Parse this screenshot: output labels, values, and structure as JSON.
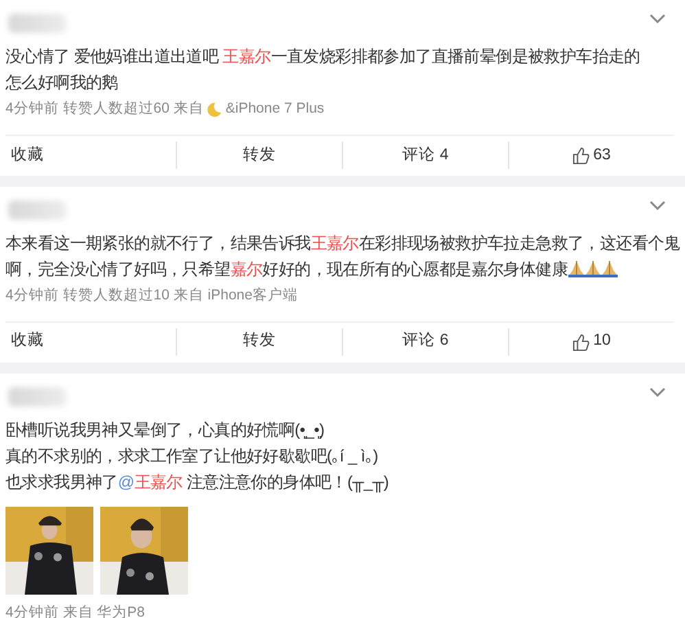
{
  "posts": [
    {
      "username": {
        "kind": "blurred"
      },
      "lines": [
        [
          {
            "kind": "plain",
            "text": "没心情了 爱他妈谁出道出道吧 "
          },
          {
            "kind": "name",
            "text": "王嘉尔"
          },
          {
            "kind": "plain",
            "text": "一直发烧彩排都参加了直播前晕倒是被救护车抬走的"
          }
        ],
        [
          {
            "kind": "plain",
            "text": "怎么好啊我的鹅"
          }
        ]
      ],
      "meta": [
        {
          "kind": "text",
          "text": "4分钟前 转赞人数超过60 来自"
        },
        {
          "kind": "moon"
        },
        {
          "kind": "text",
          "text": "&iPhone 7 Plus"
        }
      ],
      "actions": [
        {
          "kind": "text",
          "label": "收藏"
        },
        {
          "kind": "text",
          "label": "转发"
        },
        {
          "kind": "text",
          "label": "评论 4"
        },
        {
          "kind": "like",
          "label": "63"
        }
      ]
    },
    {
      "username": {
        "kind": "blurred"
      },
      "lines": [
        [
          {
            "kind": "plain",
            "text": "本来看这一期紧张的就不行了，结果告诉我"
          },
          {
            "kind": "name",
            "text": "王嘉尔"
          },
          {
            "kind": "plain",
            "text": "在彩排现场被救护车拉走急救了，这还看个鬼"
          }
        ],
        [
          {
            "kind": "plain",
            "text": "啊，完全没心情了好吗，只希望"
          },
          {
            "kind": "name",
            "text": "嘉尔"
          },
          {
            "kind": "plain",
            "text": "好好的，现在所有的心愿都是嘉尔身体健康"
          },
          {
            "kind": "pray"
          },
          {
            "kind": "pray"
          },
          {
            "kind": "pray"
          }
        ]
      ],
      "meta": [
        {
          "kind": "text",
          "text": "4分钟前 转赞人数超过10 来自 iPhone客户端"
        }
      ],
      "actions": [
        {
          "kind": "text",
          "label": "收藏"
        },
        {
          "kind": "text",
          "label": "转发"
        },
        {
          "kind": "text",
          "label": "评论 6"
        },
        {
          "kind": "like",
          "label": "10"
        }
      ]
    },
    {
      "username": {
        "kind": "blurred"
      },
      "lines": [
        [
          {
            "kind": "plain",
            "text": "卧槽听说我男神又晕倒了，心真的好慌啊(•͈_•͈)"
          }
        ],
        [
          {
            "kind": "plain",
            "text": "真的不求别的，求求工作室了让他好好歇歇吧(｡í _ ì｡)"
          }
        ],
        [
          {
            "kind": "plain",
            "text": "也求求我男神了"
          },
          {
            "kind": "at",
            "text": "@"
          },
          {
            "kind": "name",
            "text": "王嘉尔"
          },
          {
            "kind": "plain",
            "text": " 注意注意你的身体吧！(╥_╥)"
          }
        ]
      ],
      "images": [
        {
          "kind": "picture"
        },
        {
          "kind": "picture"
        }
      ],
      "meta": [
        {
          "kind": "text",
          "text": "4分钟前 来自 华为P8"
        }
      ]
    }
  ]
}
